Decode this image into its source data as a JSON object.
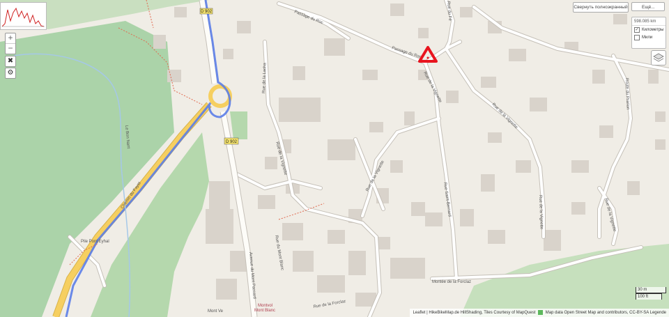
{
  "toolbar": {
    "fullscreen_label": "Свернуть полноэкранный",
    "more_label": "Ещё..."
  },
  "zoom": {
    "in": "+",
    "out": "−"
  },
  "distance_panel": {
    "value": "598.085 km",
    "units": [
      {
        "label": "Километры",
        "checked": true
      },
      {
        "label": "Мили",
        "checked": false
      }
    ]
  },
  "route_labels": {
    "d902_a": "D 902",
    "d902_b": "D 902"
  },
  "streets": {
    "passage_roc_a": "Passage du Roc",
    "passage_roc_b": "Passage du Roc",
    "rue_fe": "Rue du Fé",
    "rue_lacha": "Rue de la Lacha",
    "rue_vignette_a": "Rue de la Vignette",
    "rue_vignette_b": "Rue de la Vignette",
    "rue_vignette_c": "Rue de la Vignette",
    "rue_vignette_d": "Rue de la Vignette",
    "rue_vignette_e": "Rue de la Vignette",
    "rue_saint_bernard": "Rue Saint-Bernard",
    "rue_prarion": "Route du Prarion",
    "rue_mont_blanc": "Rue du Mont Blanc",
    "avenue_mont_paccard": "Avenue du Mont Paccard",
    "montee_forclaz": "Montée de la Forclaz",
    "rue_forclaz": "Rue de la Forclaz",
    "bon_nant": "Le Bon Nant",
    "chemin_fayet": "Chemin du Fayet",
    "pont_eyhal": "Pile Pont Eyhal",
    "mont_blanc_a": "Mont Blanc",
    "montvol": "Montvol",
    "mont_ve": "Mont Ve"
  },
  "scale": {
    "meters": "30 m",
    "feet": "100 ft"
  },
  "attribution": {
    "text": "Leaflet | HikeBikeMap.de HillShading, Tiles Courtesy of MapQuest",
    "text2": "Map data Open Street Map and contributors, CC-BY-SA Legende"
  },
  "colors": {
    "background": "#f0ede6",
    "forest": "#abd3a9",
    "building": "#d9d3cb",
    "route": "#5b7de8",
    "primary_road": "#f6cf60",
    "marker": "#e8141e"
  }
}
